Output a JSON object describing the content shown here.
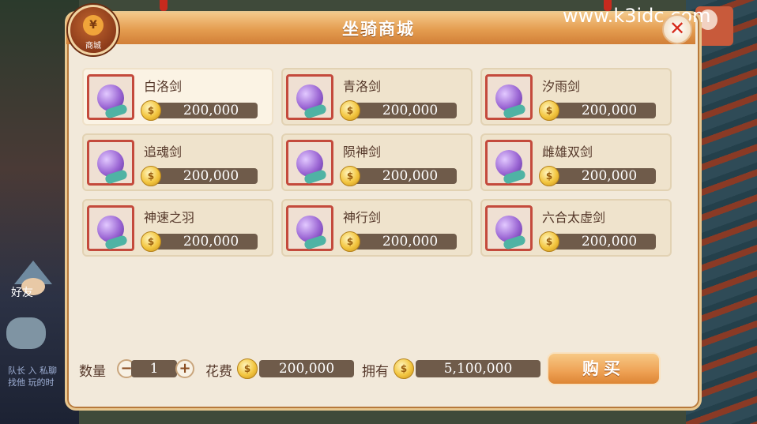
{
  "title": "坐骑商城",
  "mall_badge": {
    "symbol": "¥",
    "label": "商城"
  },
  "close_symbol": "✕",
  "watermark": "www.k3idc.com",
  "background": {
    "friend_label": "好友",
    "left_text": "队长 入 私聊找他 玩的时"
  },
  "items": [
    {
      "name": "白洛剑",
      "price": "200,000",
      "selected": true
    },
    {
      "name": "青洛剑",
      "price": "200,000"
    },
    {
      "name": "汐雨剑",
      "price": "200,000"
    },
    {
      "name": "追魂剑",
      "price": "200,000"
    },
    {
      "name": "陨神剑",
      "price": "200,000"
    },
    {
      "name": "雌雄双剑",
      "price": "200,000"
    },
    {
      "name": "神速之羽",
      "price": "200,000"
    },
    {
      "name": "神行剑",
      "price": "200,000"
    },
    {
      "name": "六合太虚剑",
      "price": "200,000"
    }
  ],
  "bottom": {
    "qty_label": "数量",
    "qty_minus": "−",
    "qty_value": "1",
    "qty_plus": "+",
    "cost_label": "花费",
    "cost_value": "200,000",
    "own_label": "拥有",
    "own_value": "5,100,000",
    "buy_label": "购买"
  },
  "coin_symbol": "$",
  "colors": {
    "title_bar": "#e49c4f",
    "panel_bg": "#f2e9da",
    "price_bar": "#6f5b4a",
    "icon_border": "#c44a3c",
    "close_x": "#d62a1b"
  }
}
